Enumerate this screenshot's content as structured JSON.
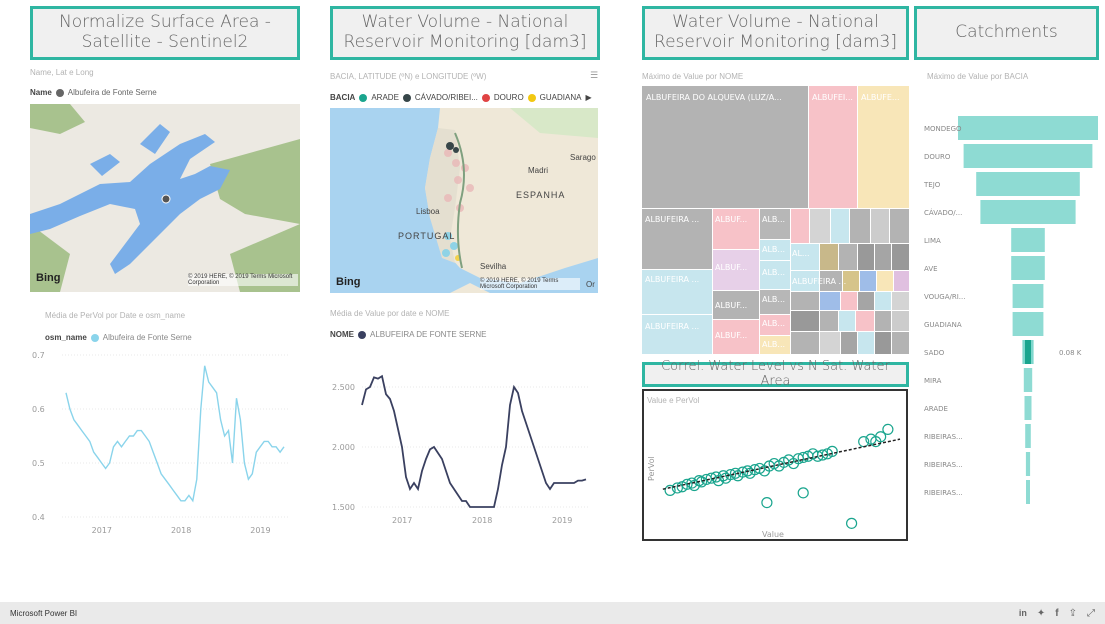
{
  "headers": {
    "h1": [
      "Normalize Surface Area -",
      "Satellite - Sentinel2"
    ],
    "h2": [
      "Water Volume - National",
      "Reservoir Monitoring [dam3]"
    ],
    "h3": [
      "Water Volume - National",
      "Reservoir Monitoring [dam3]"
    ],
    "h4": [
      "Catchments"
    ],
    "h5": [
      "Correl. Water Level vs N Sat. Water Area"
    ]
  },
  "map1": {
    "subtitle": "Name, Lat e Long",
    "legend_title": "Name",
    "legend_item": "Albufeira de Fonte Serne",
    "bing": "Bing",
    "credit": "© 2019 HERE, © 2019 Terms Microsoft Corporation"
  },
  "map2": {
    "subtitle": "BACIA, LATITUDE (ºN) e LONGITUDE (ºW)",
    "legend_title": "BACIA",
    "legend_items": [
      "ARADE",
      "CÁVADO/RIBEI...",
      "DOURO",
      "GUADIANA"
    ],
    "legend_colors": [
      "#1aa58e",
      "#374649",
      "#e04343",
      "#f2c811"
    ],
    "places": [
      "Madri",
      "Sarago",
      "ESPANHA",
      "Lisboa",
      "PORTUGAL",
      "Sevilha",
      "Or"
    ],
    "bing": "Bing",
    "credit": "© 2019 HERE, © 2019 Terms Microsoft Corporation"
  },
  "treemap": {
    "subtitle": "Máximo de Value por NOME",
    "labels": [
      "ALBUFEIRA DO ALQUEVA (LUZ/A...",
      "ALBUFEI...",
      "ALBUFE...",
      "ALBUFEIRA ...",
      "ALBUF...",
      "ALB...",
      "ALB...",
      "AL...",
      "ALBUFEIRA ...",
      "ALBUF...",
      "ALB...",
      "ALBUFEIRA ...",
      "ALBUF...",
      "ALB...",
      "ALBUFEIRA ...",
      "ALBUF...",
      "ALB...",
      "ALB..."
    ]
  },
  "funnel": {
    "subtitle": "Máximo de Value por BACIA",
    "datalabel": "0.08 K"
  },
  "line1": {
    "subtitle": "Média de PerVol por Date e osm_name",
    "legend_title": "osm_name",
    "legend_item": "Albufeira de Fonte Serne"
  },
  "line2": {
    "subtitle": "Média de Value por date e NOME",
    "legend_title": "NOME",
    "legend_item": "ALBUFEIRA DE FONTE SERNE"
  },
  "scatter": {
    "subtitle": "Value e PerVol"
  },
  "footer": {
    "brand": "Microsoft Power BI",
    "icons": [
      "linkedin-icon",
      "twitter-icon",
      "facebook-icon",
      "share-icon",
      "fullscreen-icon"
    ]
  },
  "chart_data": [
    {
      "type": "line",
      "title": "Média de PerVol por Date e osm_name",
      "xlabel": "",
      "ylabel": "",
      "series": [
        {
          "name": "Albufeira de Fonte Serne",
          "color": "#8ad4eb",
          "x": [
            2016.55,
            2016.6,
            2016.65,
            2016.7,
            2016.75,
            2016.8,
            2016.85,
            2016.9,
            2016.95,
            2017.0,
            2017.05,
            2017.1,
            2017.15,
            2017.2,
            2017.25,
            2017.3,
            2017.35,
            2017.4,
            2017.45,
            2017.5,
            2017.55,
            2017.6,
            2017.65,
            2017.7,
            2017.75,
            2017.8,
            2017.85,
            2017.9,
            2017.95,
            2018.0,
            2018.05,
            2018.1,
            2018.15,
            2018.2,
            2018.25,
            2018.3,
            2018.35,
            2018.4,
            2018.45,
            2018.5,
            2018.55,
            2018.6,
            2018.65,
            2018.7,
            2018.75,
            2018.8,
            2018.85,
            2018.9,
            2018.95,
            2019.0,
            2019.05,
            2019.1,
            2019.15,
            2019.2,
            2019.25,
            2019.3
          ],
          "y": [
            0.63,
            0.6,
            0.58,
            0.57,
            0.56,
            0.55,
            0.54,
            0.52,
            0.51,
            0.5,
            0.49,
            0.5,
            0.53,
            0.54,
            0.53,
            0.54,
            0.55,
            0.55,
            0.56,
            0.56,
            0.55,
            0.54,
            0.52,
            0.5,
            0.48,
            0.47,
            0.46,
            0.45,
            0.44,
            0.43,
            0.43,
            0.44,
            0.43,
            0.47,
            0.6,
            0.68,
            0.65,
            0.64,
            0.63,
            0.58,
            0.55,
            0.56,
            0.5,
            0.62,
            0.58,
            0.5,
            0.47,
            0.48,
            0.52,
            0.53,
            0.54,
            0.54,
            0.53,
            0.53,
            0.52,
            0.53
          ]
        }
      ],
      "xlim": [
        2016.5,
        2019.35
      ],
      "ylim": [
        0.4,
        0.7
      ],
      "yticks": [
        "0.4",
        "0.5",
        "0.6",
        "0.7"
      ],
      "xticks": [
        "2017",
        "2018",
        "2019"
      ]
    },
    {
      "type": "line",
      "title": "Média de Value por date e NOME",
      "xlabel": "",
      "ylabel": "",
      "series": [
        {
          "name": "ALBUFEIRA DE FONTE SERNE",
          "color": "#3a4060",
          "x": [
            2016.5,
            2016.55,
            2016.6,
            2016.65,
            2016.7,
            2016.75,
            2016.8,
            2016.85,
            2016.9,
            2016.95,
            2017.0,
            2017.05,
            2017.1,
            2017.15,
            2017.2,
            2017.25,
            2017.3,
            2017.35,
            2017.4,
            2017.45,
            2017.5,
            2017.55,
            2017.6,
            2017.65,
            2017.7,
            2017.75,
            2017.8,
            2017.85,
            2017.9,
            2017.95,
            2018.0,
            2018.05,
            2018.1,
            2018.15,
            2018.2,
            2018.25,
            2018.3,
            2018.35,
            2018.4,
            2018.45,
            2018.5,
            2018.55,
            2018.6,
            2018.65,
            2018.7,
            2018.75,
            2018.8,
            2018.85,
            2018.9,
            2018.95,
            2019.0,
            2019.05,
            2019.1,
            2019.15,
            2019.2,
            2019.25,
            2019.3
          ],
          "y": [
            2350,
            2480,
            2500,
            2580,
            2570,
            2590,
            2440,
            2400,
            2300,
            2150,
            2000,
            1750,
            1650,
            1700,
            1650,
            1800,
            1900,
            1980,
            2000,
            1950,
            1900,
            1800,
            1700,
            1650,
            1600,
            1550,
            1550,
            1500,
            1500,
            1500,
            1500,
            1500,
            1500,
            1500,
            1650,
            1850,
            2000,
            2350,
            2500,
            2450,
            2300,
            2200,
            2100,
            2000,
            1900,
            1800,
            1700,
            1650,
            1700,
            1700,
            1700,
            1700,
            1700,
            1700,
            1720,
            1720,
            1730
          ]
        }
      ],
      "xlim": [
        2016.5,
        2019.35
      ],
      "ylim": [
        1500,
        2600
      ],
      "yticks": [
        "1.500",
        "2.000",
        "2.500"
      ],
      "xticks": [
        "2017",
        "2018",
        "2019"
      ]
    },
    {
      "type": "bar",
      "title": "Máximo de Value por BACIA",
      "categories": [
        "MONDEGO",
        "DOURO",
        "TEJO",
        "CÁVADO/...",
        "LIMA",
        "AVE",
        "VOUGA/RI...",
        "GUADIANA",
        "SADO",
        "MIRA",
        "ARADE",
        "RIBEIRAS...",
        "RIBEIRAS...",
        "RIBEIRAS..."
      ],
      "values": [
        1.0,
        0.92,
        0.74,
        0.68,
        0.24,
        0.24,
        0.22,
        0.22,
        0.08,
        0.06,
        0.05,
        0.04,
        0.03,
        0.02
      ],
      "highlight_value": "0.08 K"
    },
    {
      "type": "scatter",
      "title": "Value e PerVol",
      "xlabel": "Value",
      "ylabel": "PerVol",
      "series": [
        {
          "name": "",
          "color": "#1aa58e",
          "x": [
            0.05,
            0.08,
            0.1,
            0.12,
            0.14,
            0.15,
            0.17,
            0.18,
            0.2,
            0.22,
            0.24,
            0.25,
            0.27,
            0.28,
            0.3,
            0.32,
            0.33,
            0.35,
            0.37,
            0.38,
            0.4,
            0.42,
            0.44,
            0.46,
            0.48,
            0.5,
            0.52,
            0.54,
            0.56,
            0.58,
            0.6,
            0.62,
            0.64,
            0.66,
            0.68,
            0.7,
            0.72,
            0.85,
            0.88,
            0.9,
            0.92,
            0.95,
            0.6,
            0.45,
            0.8
          ],
          "y": [
            0.3,
            0.32,
            0.33,
            0.35,
            0.36,
            0.34,
            0.38,
            0.37,
            0.39,
            0.4,
            0.41,
            0.38,
            0.42,
            0.4,
            0.43,
            0.44,
            0.42,
            0.45,
            0.46,
            0.44,
            0.47,
            0.48,
            0.46,
            0.5,
            0.52,
            0.5,
            0.53,
            0.55,
            0.52,
            0.56,
            0.57,
            0.58,
            0.6,
            0.58,
            0.59,
            0.6,
            0.62,
            0.7,
            0.72,
            0.7,
            0.74,
            0.8,
            0.28,
            0.2,
            0.03
          ]
        }
      ],
      "trend": true
    }
  ]
}
